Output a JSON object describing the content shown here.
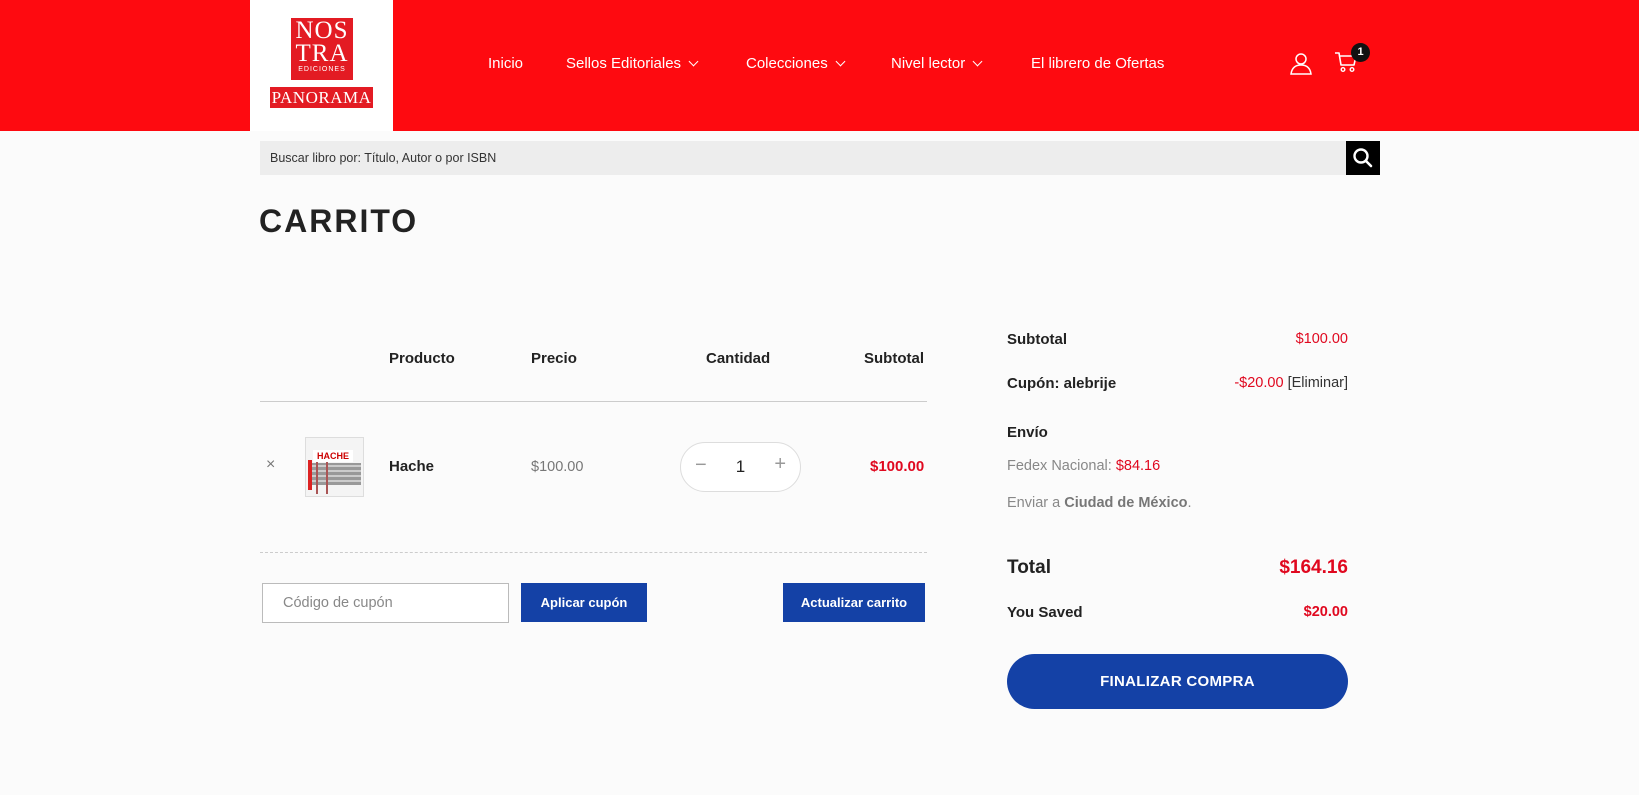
{
  "brand": {
    "logo_line1": "NOS",
    "logo_line2": "TRA",
    "logo_sub": "EDICIONES",
    "logo_band": "PANORAMA"
  },
  "nav": {
    "items": [
      {
        "label": "Inicio",
        "dropdown": false
      },
      {
        "label": "Sellos Editoriales",
        "dropdown": true
      },
      {
        "label": "Colecciones",
        "dropdown": true
      },
      {
        "label": "Nivel lector",
        "dropdown": true
      },
      {
        "label": "El librero de Ofertas",
        "dropdown": false
      }
    ],
    "cart_count": "1"
  },
  "search": {
    "placeholder": "Buscar libro por: Título, Autor o por ISBN"
  },
  "page": {
    "title": "CARRITO"
  },
  "cart_table": {
    "headers": [
      "Producto",
      "Precio",
      "Cantidad",
      "Subtotal"
    ],
    "items": [
      {
        "remove": "×",
        "thumb_text": "HACHE",
        "name": "Hache",
        "price": "$100.00",
        "quantity": "1",
        "subtotal": "$100.00"
      }
    ],
    "qty_minus": "−",
    "qty_plus": "+",
    "coupon_placeholder": "Código de cupón",
    "apply_coupon": "Aplicar cupón",
    "update_cart": "Actualizar carrito"
  },
  "totals": {
    "subtotal_label": "Subtotal",
    "subtotal_value": "$100.00",
    "coupon_label": "Cupón: alebrije",
    "coupon_value": "-$20.00",
    "coupon_remove": "[Eliminar]",
    "shipping_label": "Envío",
    "shipping_method": "Fedex Nacional:",
    "shipping_cost": "$84.16",
    "ship_to_prefix": "Enviar a",
    "ship_to_city": "Ciudad de México",
    "ship_to_suffix": ".",
    "total_label": "Total",
    "total_value": "$164.16",
    "saved_label": "You Saved",
    "saved_value": "$20.00",
    "checkout": "FINALIZAR COMPRA"
  },
  "colors": {
    "header_red": "#fe0a10",
    "accent_blue": "#1441a6",
    "price_red": "#e0081f"
  }
}
